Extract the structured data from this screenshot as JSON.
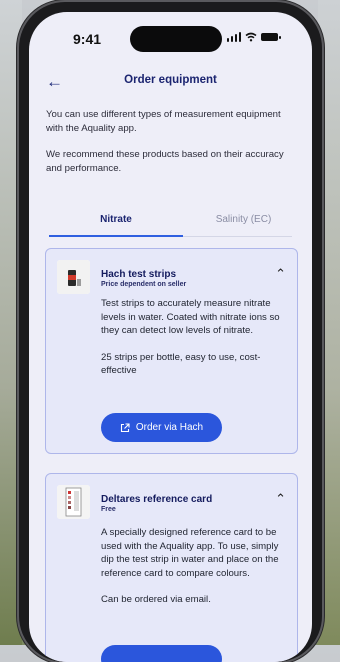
{
  "status_bar": {
    "time": "9:41"
  },
  "nav": {
    "back_icon": "arrow-left-icon",
    "title": "Order equipment"
  },
  "intro": {
    "p1": "You can use different types of measurement equipment with the Aquality app.",
    "p2": "We recommend these products based on their accuracy and performance."
  },
  "tabs": [
    {
      "label": "Nitrate",
      "active": true
    },
    {
      "label": "Salinity (EC)",
      "active": false
    }
  ],
  "products": [
    {
      "name": "Hach test strips",
      "subtitle": "Price dependent on seller",
      "desc1": "Test strips to accurately measure nitrate levels in water. Coated with nitrate ions so they can detect low levels of nitrate.",
      "desc2": "25 strips per bottle, easy to use, cost-effective",
      "button": "Order via Hach",
      "button_icon": "external-link-icon",
      "expanded": true
    },
    {
      "name": "Deltares reference card",
      "subtitle": "Free",
      "desc1": "A specially designed reference card to be used with the Aquality app. To use, simply dip the test strip in water and place on the reference card to compare colours.",
      "desc2": "Can be ordered via email.",
      "expanded": true
    }
  ],
  "colors": {
    "accent": "#2b56dc",
    "card_bg": "#e6e8f9",
    "title": "#1b2470"
  }
}
